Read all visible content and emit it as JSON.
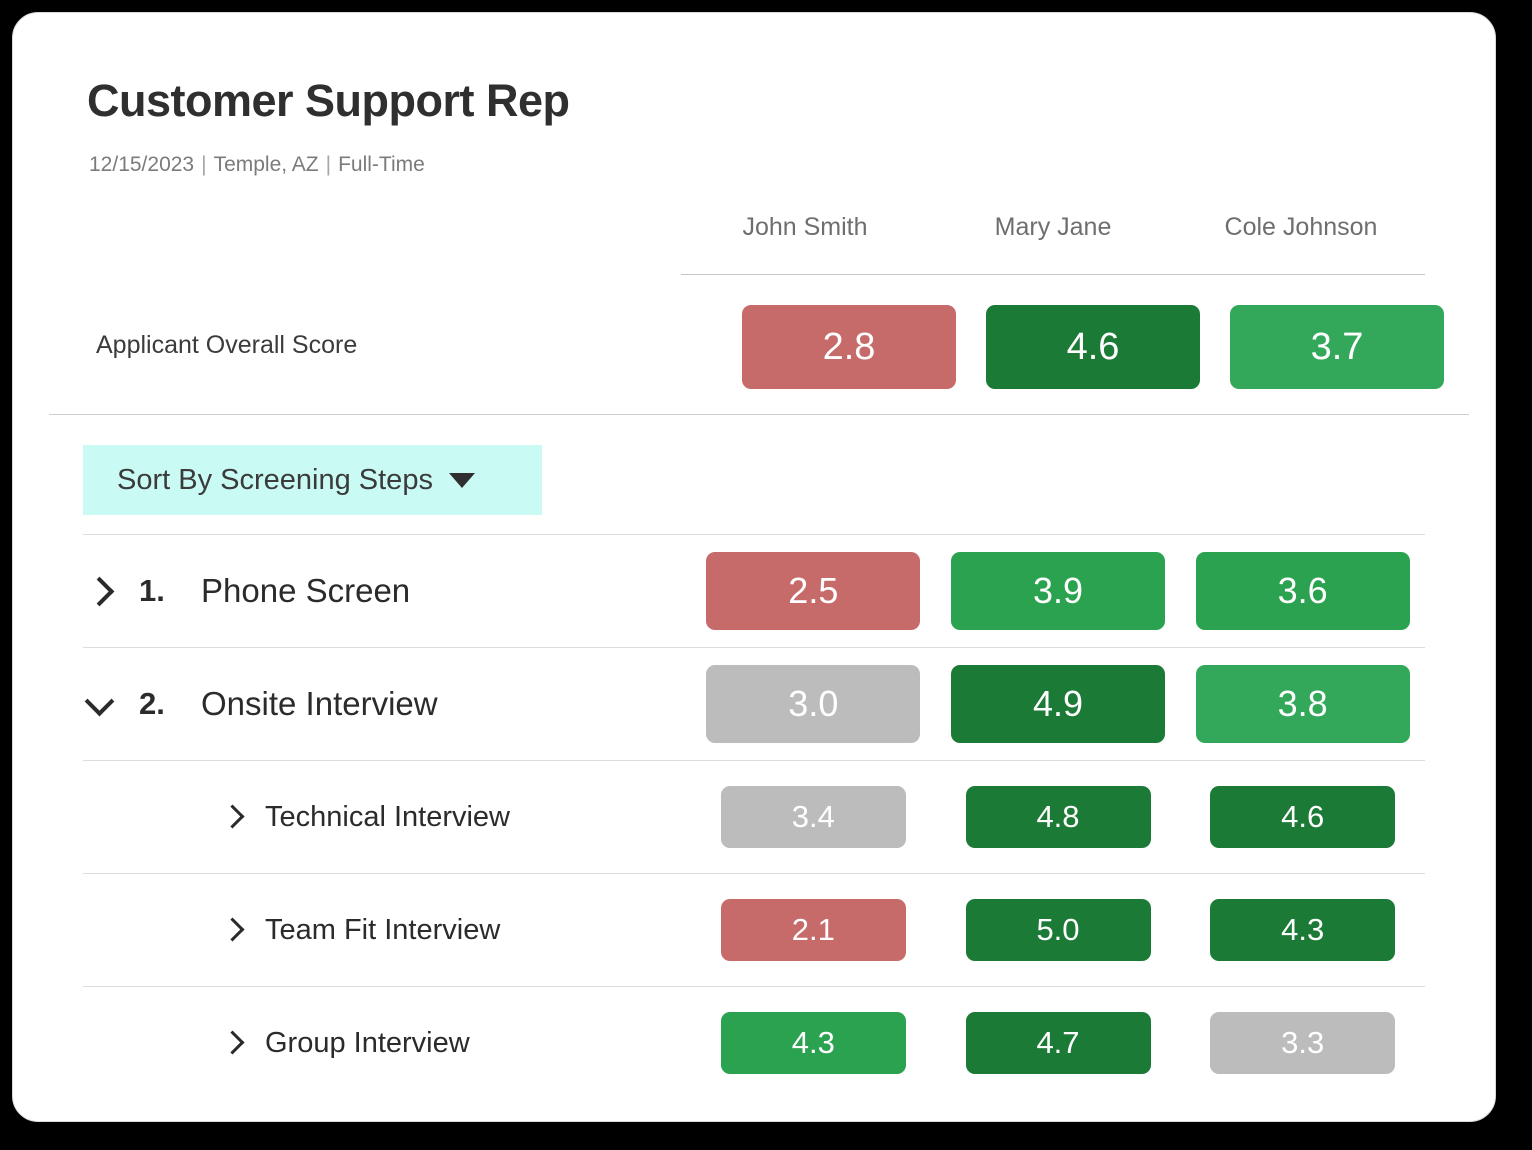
{
  "header": {
    "title": "Customer Support Rep",
    "date": "12/15/2023",
    "location": "Temple, AZ",
    "employment_type": "Full-Time",
    "separator": "|"
  },
  "candidates": [
    {
      "name": "John Smith"
    },
    {
      "name": "Mary Jane"
    },
    {
      "name": "Cole Johnson"
    }
  ],
  "overall": {
    "label": "Applicant Overall Score",
    "scores": [
      {
        "value": "2.8",
        "color": "#c76a6a"
      },
      {
        "value": "4.6",
        "color": "#1b7a35"
      },
      {
        "value": "3.7",
        "color": "#34a85a"
      }
    ]
  },
  "sort": {
    "label": "Sort By Screening Steps",
    "caret_icon": "chevron-down-icon",
    "background": "#c9fbf4"
  },
  "steps": [
    {
      "number": "1.",
      "name": "Phone Screen",
      "expanded": false,
      "chevron_icon": "chevron-right-icon",
      "scores": [
        {
          "value": "2.5",
          "color": "#c76a6a"
        },
        {
          "value": "3.9",
          "color": "#2ba24f"
        },
        {
          "value": "3.6",
          "color": "#2ba24f"
        }
      ]
    },
    {
      "number": "2.",
      "name": "Onsite Interview",
      "expanded": true,
      "chevron_icon": "chevron-down-icon",
      "scores": [
        {
          "value": "3.0",
          "color": "#bcbcbc"
        },
        {
          "value": "4.9",
          "color": "#1b7a35"
        },
        {
          "value": "3.8",
          "color": "#34a85a"
        }
      ],
      "substeps": [
        {
          "name": "Technical Interview",
          "chevron_icon": "chevron-right-icon",
          "scores": [
            {
              "value": "3.4",
              "color": "#bcbcbc"
            },
            {
              "value": "4.8",
              "color": "#1b7a35"
            },
            {
              "value": "4.6",
              "color": "#1b7a35"
            }
          ]
        },
        {
          "name": "Team Fit Interview",
          "chevron_icon": "chevron-right-icon",
          "scores": [
            {
              "value": "2.1",
              "color": "#c76a6a"
            },
            {
              "value": "5.0",
              "color": "#1b7a35"
            },
            {
              "value": "4.3",
              "color": "#1b7a35"
            }
          ]
        },
        {
          "name": "Group Interview",
          "chevron_icon": "chevron-right-icon",
          "scores": [
            {
              "value": "4.3",
              "color": "#2ba24f"
            },
            {
              "value": "4.7",
              "color": "#1b7a35"
            },
            {
              "value": "3.3",
              "color": "#bcbcbc"
            }
          ]
        }
      ]
    }
  ]
}
